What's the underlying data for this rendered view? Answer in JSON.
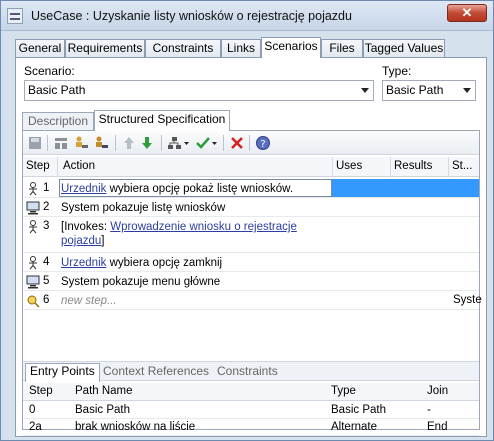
{
  "window": {
    "title": "UseCase : Uzyskanie listy wniosków o rejestrację pojazdu",
    "close_label": "✕"
  },
  "tabs": [
    "General",
    "Requirements",
    "Constraints",
    "Links",
    "Scenarios",
    "Files",
    "Tagged Values"
  ],
  "active_tab": "Scenarios",
  "scenario": {
    "label": "Scenario:",
    "value": "Basic Path"
  },
  "type": {
    "label": "Type:",
    "value": "Basic Path"
  },
  "sub_tabs": [
    "Description",
    "Structured Specification"
  ],
  "active_sub_tab": "Structured Specification",
  "toolbar_icons": [
    "save-icon",
    "insert-step-icon",
    "insert-actor-step-icon",
    "insert-system-step-icon",
    "move-up-icon",
    "move-down-icon",
    "hierarchy-icon",
    "check-icon",
    "delete-icon",
    "help-icon"
  ],
  "grid": {
    "columns": [
      "Step",
      "Action",
      "Uses",
      "Results",
      "St..."
    ],
    "rows": [
      {
        "step": "1",
        "icon": "actor-icon",
        "link": "Urzednik",
        "text": " wybiera opcję pokaż listę wniosków.",
        "selected": true
      },
      {
        "step": "2",
        "icon": "computer-icon",
        "text": "System pokazuje listę wniosków"
      },
      {
        "step": "3",
        "icon": "actor-icon",
        "prefix": "[Invokes: ",
        "link": "Wprowadzenie wniosku o rejestracje pojazdu",
        "suffix": "]"
      },
      {
        "step": "4",
        "icon": "actor-icon",
        "link": "Urzednik",
        "text": " wybiera opcję zamknij"
      },
      {
        "step": "5",
        "icon": "computer-icon",
        "text": "System pokazuje menu główne"
      },
      {
        "step": "6",
        "icon": "new-step-icon",
        "placeholder": "new step...",
        "state": "Syste"
      }
    ]
  },
  "bottom_tabs": [
    "Entry Points",
    "Context References",
    "Constraints"
  ],
  "active_bottom_tab": "Entry Points",
  "entry_points": {
    "columns": [
      "Step",
      "Path Name",
      "Type",
      "Join"
    ],
    "rows": [
      {
        "step": "0",
        "path": "Basic Path",
        "type": "Basic Path",
        "join": "-"
      },
      {
        "step": "2a",
        "path": "brak wniosków na liście",
        "type": "Alternate",
        "join": "End"
      }
    ]
  },
  "colors": {
    "selection": "#3399ff",
    "link": "#2c3fa0",
    "close": "#c24a36"
  }
}
